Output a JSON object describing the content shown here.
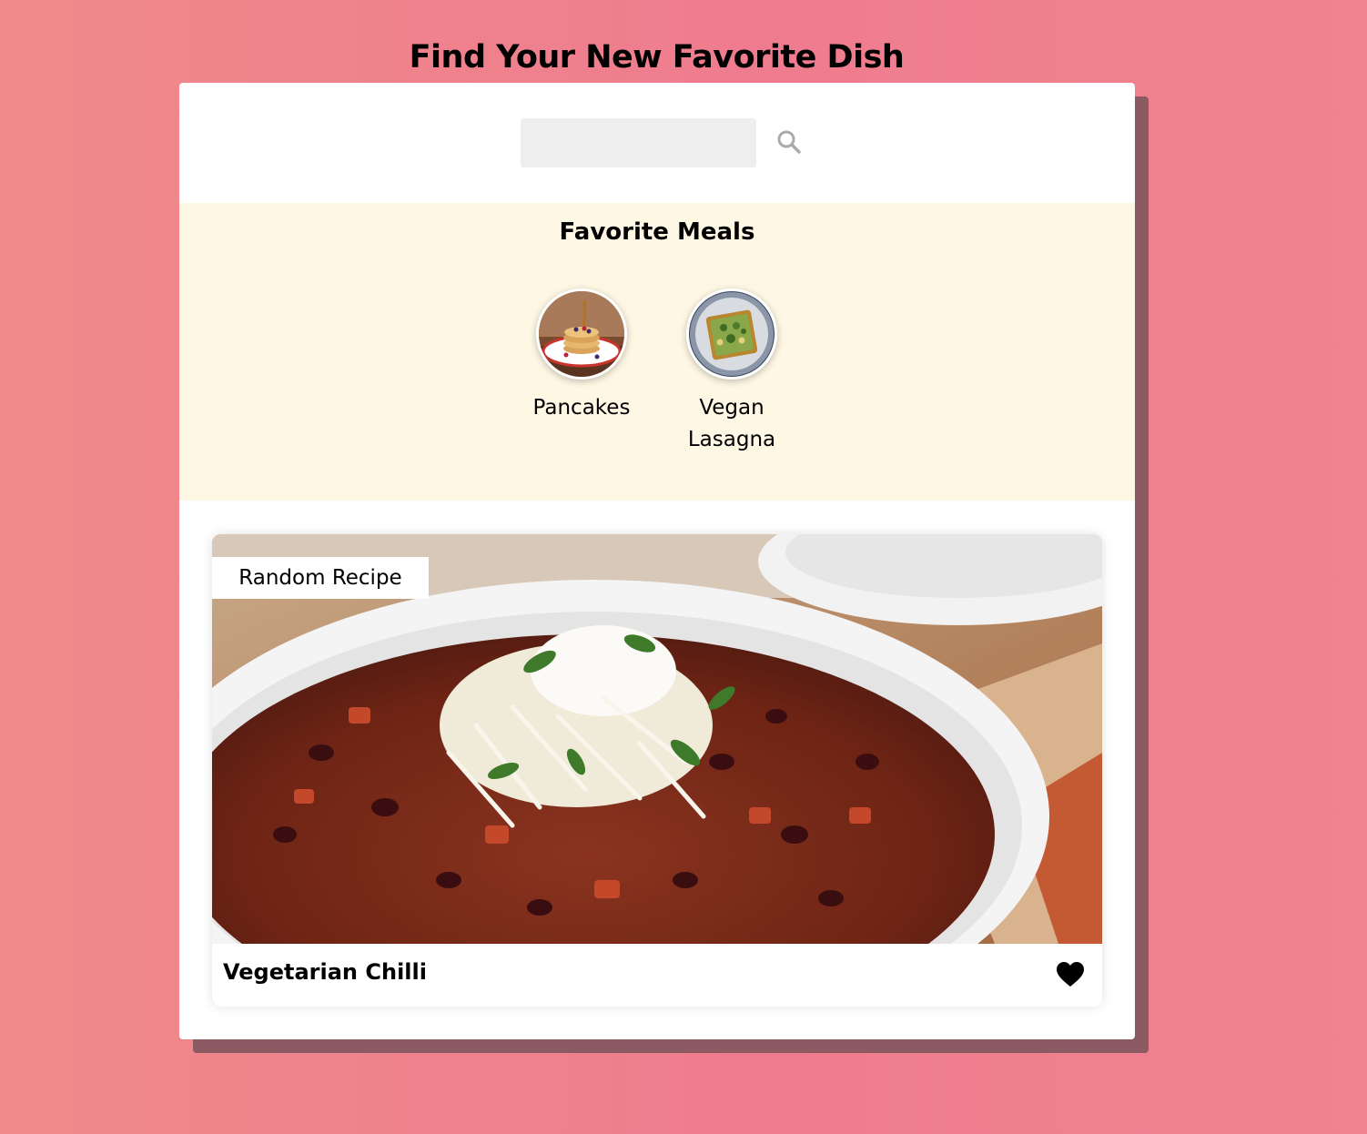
{
  "header": {
    "title": "Find Your New Favorite Dish"
  },
  "search": {
    "placeholder": "",
    "value": "",
    "button_icon": "search-icon"
  },
  "favorites": {
    "title": "Favorite Meals",
    "items": [
      {
        "label": "Pancakes",
        "image": "pancakes-photo"
      },
      {
        "label": "Vegan Lasagna",
        "image": "vegan-lasagna-photo"
      }
    ]
  },
  "random_meal": {
    "badge": "Random Recipe",
    "name": "Vegetarian Chilli",
    "image": "vegetarian-chilli-photo",
    "favorite_icon": "heart-icon"
  },
  "colors": {
    "background_gradient_start": "#ef8a8a",
    "background_gradient_end": "#f0838f",
    "card_shadow": "#8b5a62",
    "favorites_background": "#fef7e4",
    "search_input_background": "#eeeeee",
    "search_icon": "#aaaaaa"
  }
}
